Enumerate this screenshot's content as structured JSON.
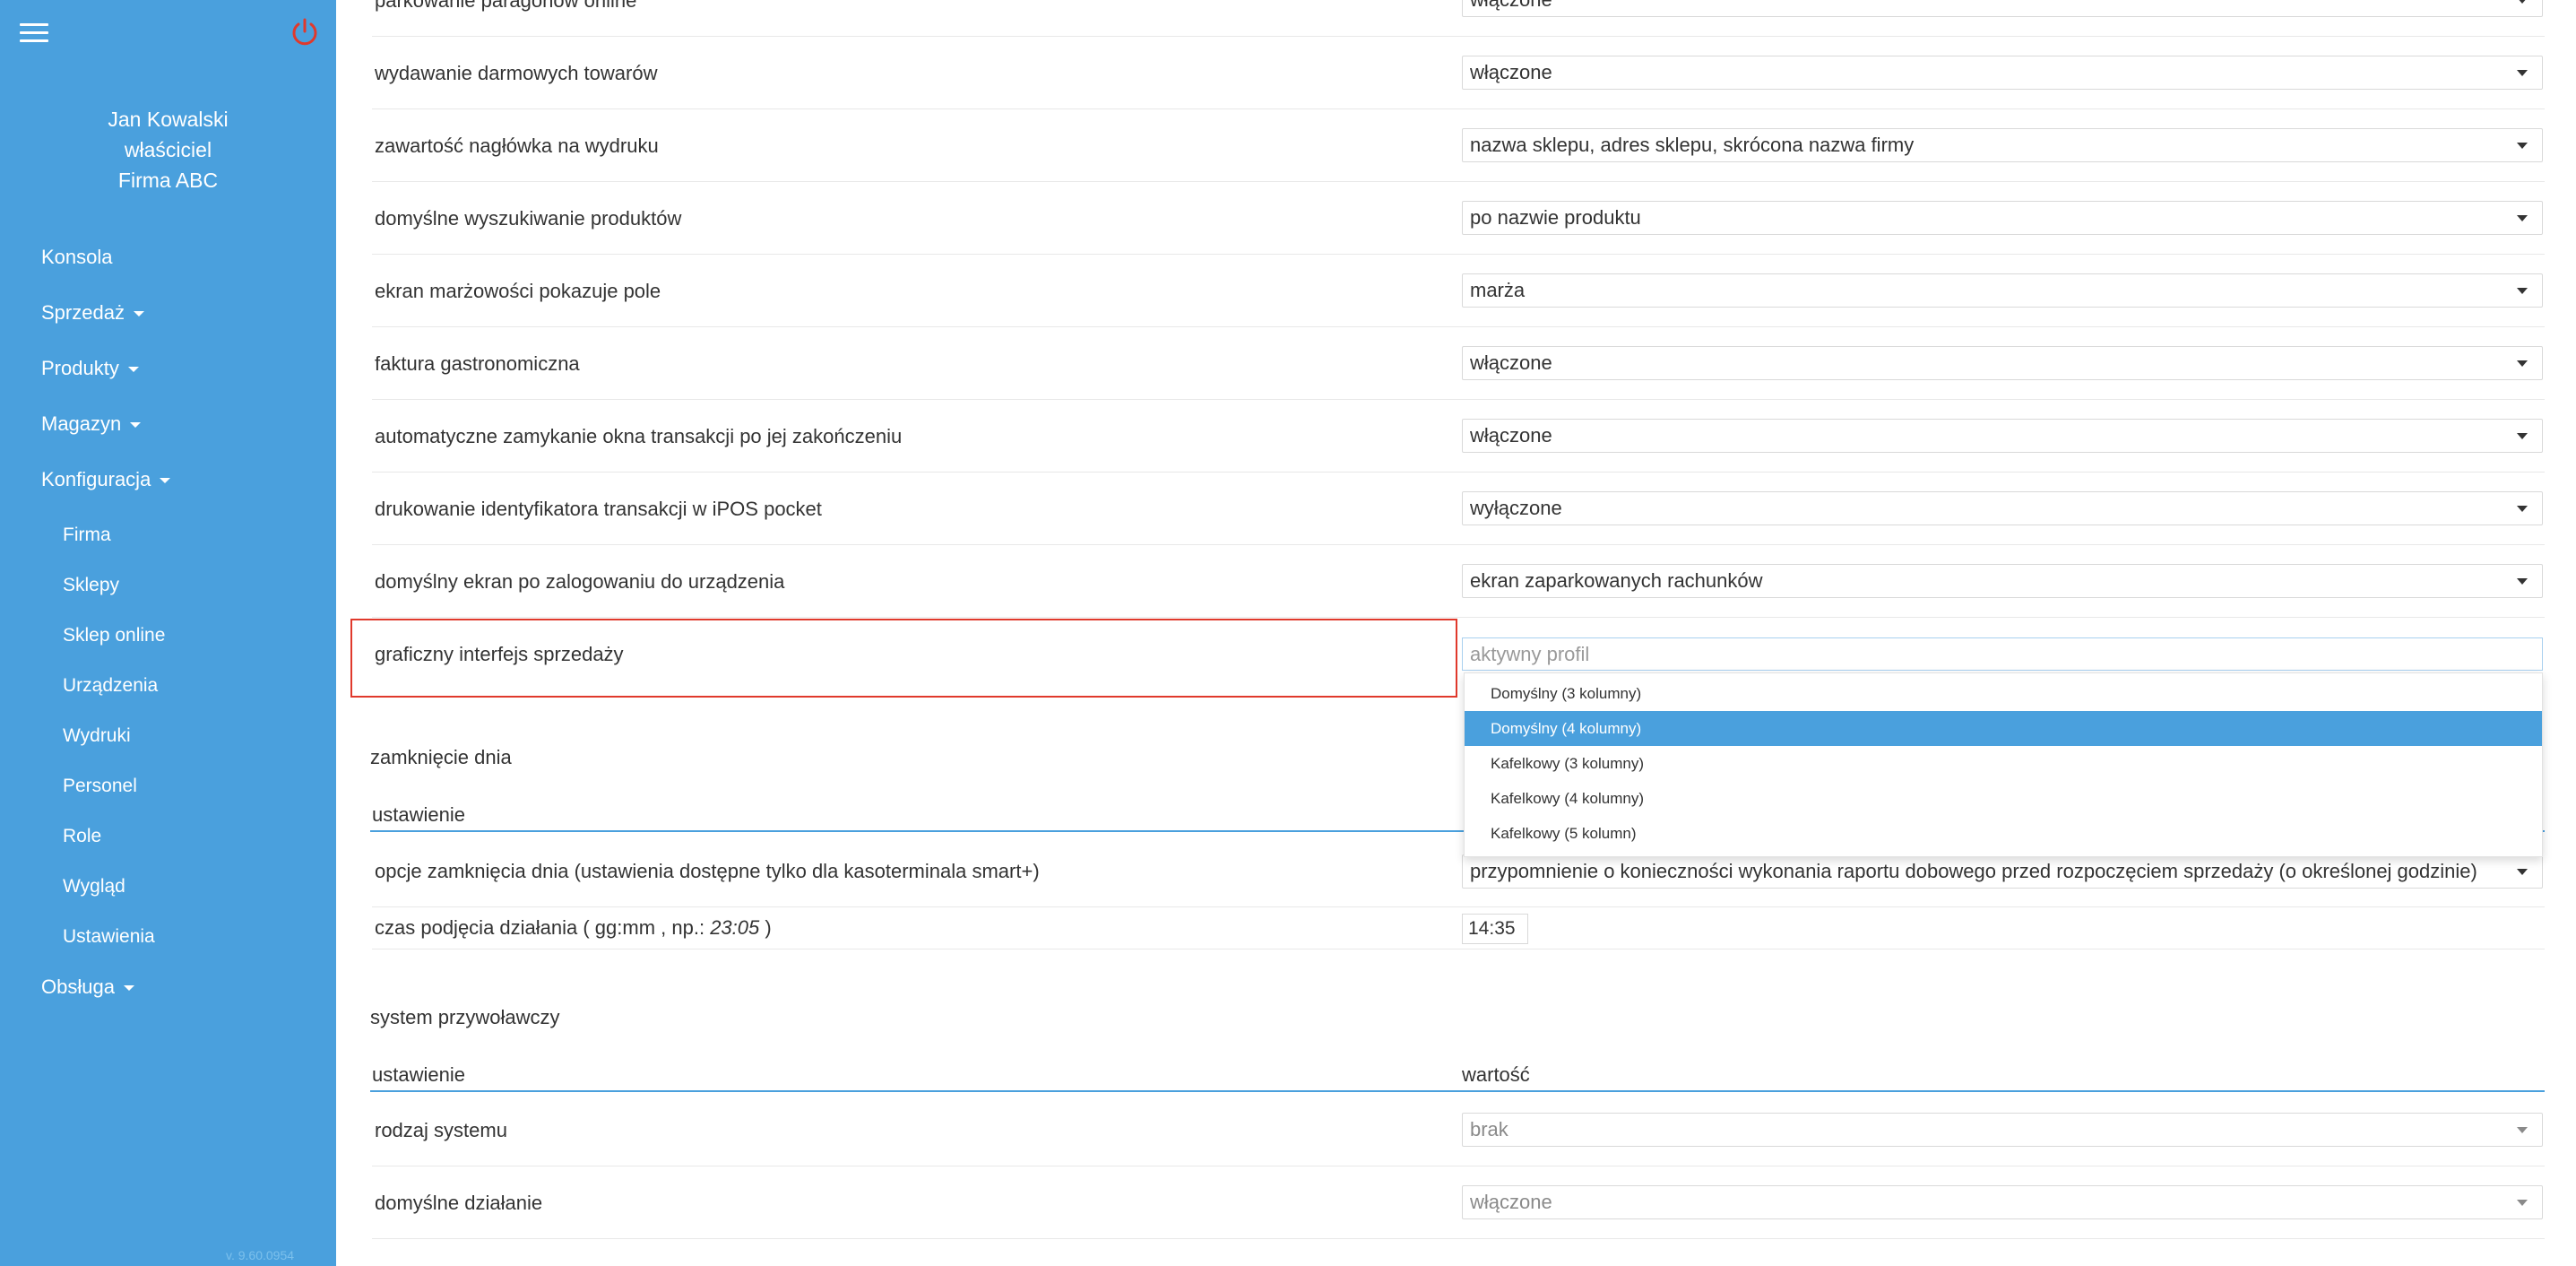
{
  "sidebar": {
    "user_name": "Jan Kowalski",
    "user_role": "właściciel",
    "company": "Firma ABC",
    "nav": {
      "konsola": "Konsola",
      "sprzedaz": "Sprzedaż",
      "produkty": "Produkty",
      "magazyn": "Magazyn",
      "konfiguracja": "Konfiguracja",
      "firma": "Firma",
      "sklepy": "Sklepy",
      "sklep_online": "Sklep online",
      "urzadzenia": "Urządzenia",
      "wydruki": "Wydruki",
      "personel": "Personel",
      "role": "Role",
      "wyglad": "Wygląd",
      "ustawienia": "Ustawienia",
      "obsluga": "Obsługa"
    },
    "version": "v. 9.60.0954",
    "accent_color": "#4aa0dd"
  },
  "settings_rows": [
    {
      "label": "parkowanie paragonów online",
      "value": "włączone"
    },
    {
      "label": "wydawanie darmowych towarów",
      "value": "włączone"
    },
    {
      "label": "zawartość nagłówka na wydruku",
      "value": "nazwa sklepu, adres sklepu, skrócona nazwa firmy"
    },
    {
      "label": "domyślne wyszukiwanie produktów",
      "value": "po nazwie produktu"
    },
    {
      "label": "ekran marżowości pokazuje pole",
      "value": "marża"
    },
    {
      "label": "faktura gastronomiczna",
      "value": "włączone"
    },
    {
      "label": "automatyczne zamykanie okna transakcji po jej zakończeniu",
      "value": "włączone"
    },
    {
      "label": "drukowanie identyfikatora transakcji w iPOS pocket",
      "value": "wyłączone"
    },
    {
      "label": "domyślny ekran po zalogowaniu do urządzenia",
      "value": "ekran zaparkowanych rachunków"
    },
    {
      "label": "graficzny interfejs sprzedaży",
      "value": ""
    }
  ],
  "dropdown": {
    "placeholder": "aktywny profil",
    "options": [
      "Domyślny (3 kolumny)",
      "Domyślny (4 kolumny)",
      "Kafelkowy (3 kolumny)",
      "Kafelkowy (4 kolumny)",
      "Kafelkowy (5 kolumn)"
    ],
    "selected_index": 1
  },
  "day_close": {
    "title": "zamknięcie dnia",
    "header_setting": "ustawienie",
    "rows": [
      {
        "label": "opcje zamknięcia dnia (ustawienia dostępne tylko dla kasoterminala smart+)",
        "value": "przypomnienie o konieczności wykonania raportu dobowego przed rozpoczęciem sprzedaży (o określonej godzinie)"
      },
      {
        "label_prefix": "czas podjęcia działania ( gg:mm , np.: ",
        "label_example": "23:05",
        "label_suffix": " )",
        "value": "14:35"
      }
    ]
  },
  "call_system": {
    "title": "system przywoławczy",
    "header_setting": "ustawienie",
    "header_value": "wartość",
    "rows": [
      {
        "label": "rodzaj systemu",
        "value": "brak"
      },
      {
        "label": "domyślne działanie",
        "value": "włączone"
      }
    ]
  }
}
